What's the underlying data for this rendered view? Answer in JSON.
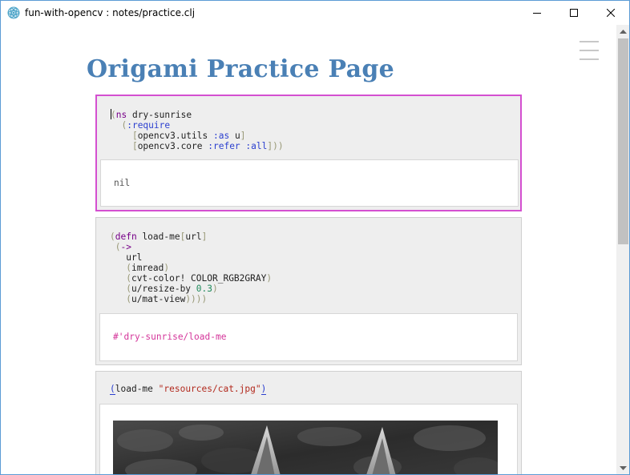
{
  "window": {
    "title": "fun-with-opencv : notes/practice.clj"
  },
  "page": {
    "title": "Origami Practice Page"
  },
  "cells": [
    {
      "code_lines": [
        [
          [
            "(",
            "paren"
          ],
          [
            "ns",
            "kw"
          ],
          [
            " dry-sunrise",
            "sym"
          ]
        ],
        [
          [
            "  (",
            "paren"
          ],
          [
            ":require",
            "key"
          ]
        ],
        [
          [
            "    [",
            "bracket"
          ],
          [
            "opencv3.utils ",
            "sym"
          ],
          [
            ":as",
            "key"
          ],
          [
            " u",
            "sym"
          ],
          [
            "]",
            "bracket"
          ]
        ],
        [
          [
            "    [",
            "bracket"
          ],
          [
            "opencv3.core ",
            "sym"
          ],
          [
            ":refer",
            "key"
          ],
          [
            " ",
            "sym"
          ],
          [
            ":all",
            "key"
          ],
          [
            "]))",
            "bracket"
          ]
        ]
      ],
      "output": "nil",
      "output_color": "#555555"
    },
    {
      "code_lines": [
        [
          [
            "(",
            "paren"
          ],
          [
            "defn",
            "kw"
          ],
          [
            " load-me",
            "sym"
          ],
          [
            "[",
            "bracket"
          ],
          [
            "url",
            "sym"
          ],
          [
            "]",
            "bracket"
          ]
        ],
        [
          [
            " (",
            "paren"
          ],
          [
            "->",
            "kw"
          ]
        ],
        [
          [
            "   url",
            "sym"
          ]
        ],
        [
          [
            "   (",
            "paren"
          ],
          [
            "imread",
            "sym"
          ],
          [
            ")",
            "paren"
          ]
        ],
        [
          [
            "   (",
            "paren"
          ],
          [
            "cvt-color! COLOR_RGB2GRAY",
            "sym"
          ],
          [
            ")",
            "paren"
          ]
        ],
        [
          [
            "   (",
            "paren"
          ],
          [
            "u/resize-by ",
            "sym"
          ],
          [
            "0.3",
            "num"
          ],
          [
            ")",
            "paren"
          ]
        ],
        [
          [
            "   (",
            "paren"
          ],
          [
            "u/mat-view",
            "sym"
          ],
          [
            "))))",
            "paren"
          ]
        ]
      ],
      "output": "#'dry-sunrise/load-me",
      "output_color": "#d4359a"
    },
    {
      "code_lines": [
        [
          [
            "(",
            "match"
          ],
          [
            "load-me ",
            "sym"
          ],
          [
            "\"resources/cat.jpg\"",
            "str"
          ],
          [
            ")",
            "match"
          ]
        ]
      ],
      "output_image": "grayscale cat photo"
    }
  ],
  "colors": {
    "title": "#4a80b5",
    "active_cell_border": "#d44fd0"
  }
}
